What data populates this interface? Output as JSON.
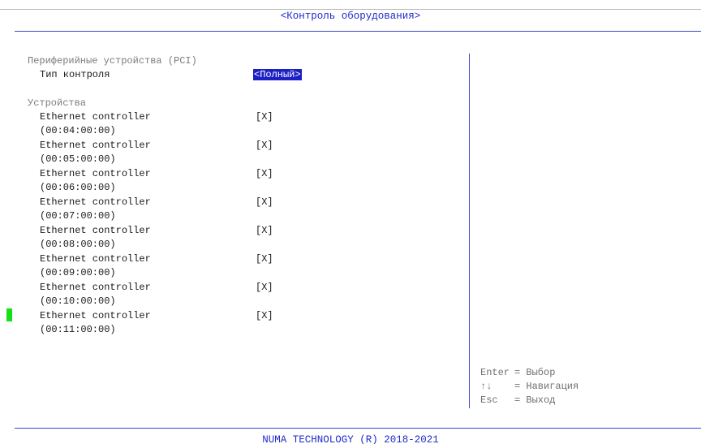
{
  "title": "<Контроль оборудования>",
  "section_pci": {
    "label": "Периферийные устройства (PCI)",
    "control_type_label": "Тип контроля",
    "control_type_value": "<Полный>"
  },
  "section_devices": {
    "label": "Устройства",
    "items": [
      {
        "name": "Ethernet controller",
        "address": "(00:04:00:00)",
        "state": "[X]"
      },
      {
        "name": "Ethernet controller",
        "address": "(00:05:00:00)",
        "state": "[X]"
      },
      {
        "name": "Ethernet controller",
        "address": "(00:06:00:00)",
        "state": "[X]"
      },
      {
        "name": "Ethernet controller",
        "address": "(00:07:00:00)",
        "state": "[X]"
      },
      {
        "name": "Ethernet controller",
        "address": "(00:08:00:00)",
        "state": "[X]"
      },
      {
        "name": "Ethernet controller",
        "address": "(00:09:00:00)",
        "state": "[X]"
      },
      {
        "name": "Ethernet controller",
        "address": "(00:10:00:00)",
        "state": "[X]"
      },
      {
        "name": "Ethernet controller",
        "address": "(00:11:00:00)",
        "state": "[X]"
      }
    ]
  },
  "help": [
    {
      "key": "Enter",
      "desc": "= Выбор"
    },
    {
      "key": "↑↓",
      "desc": "= Навигация"
    },
    {
      "key": "Esc",
      "desc": "= Выход"
    }
  ],
  "footer": "NUMA TECHNOLOGY (R) 2018-2021",
  "colors": {
    "accent": "#1f2bc9",
    "selection": "#1c20c4",
    "cursor_marker": "#16e016"
  }
}
